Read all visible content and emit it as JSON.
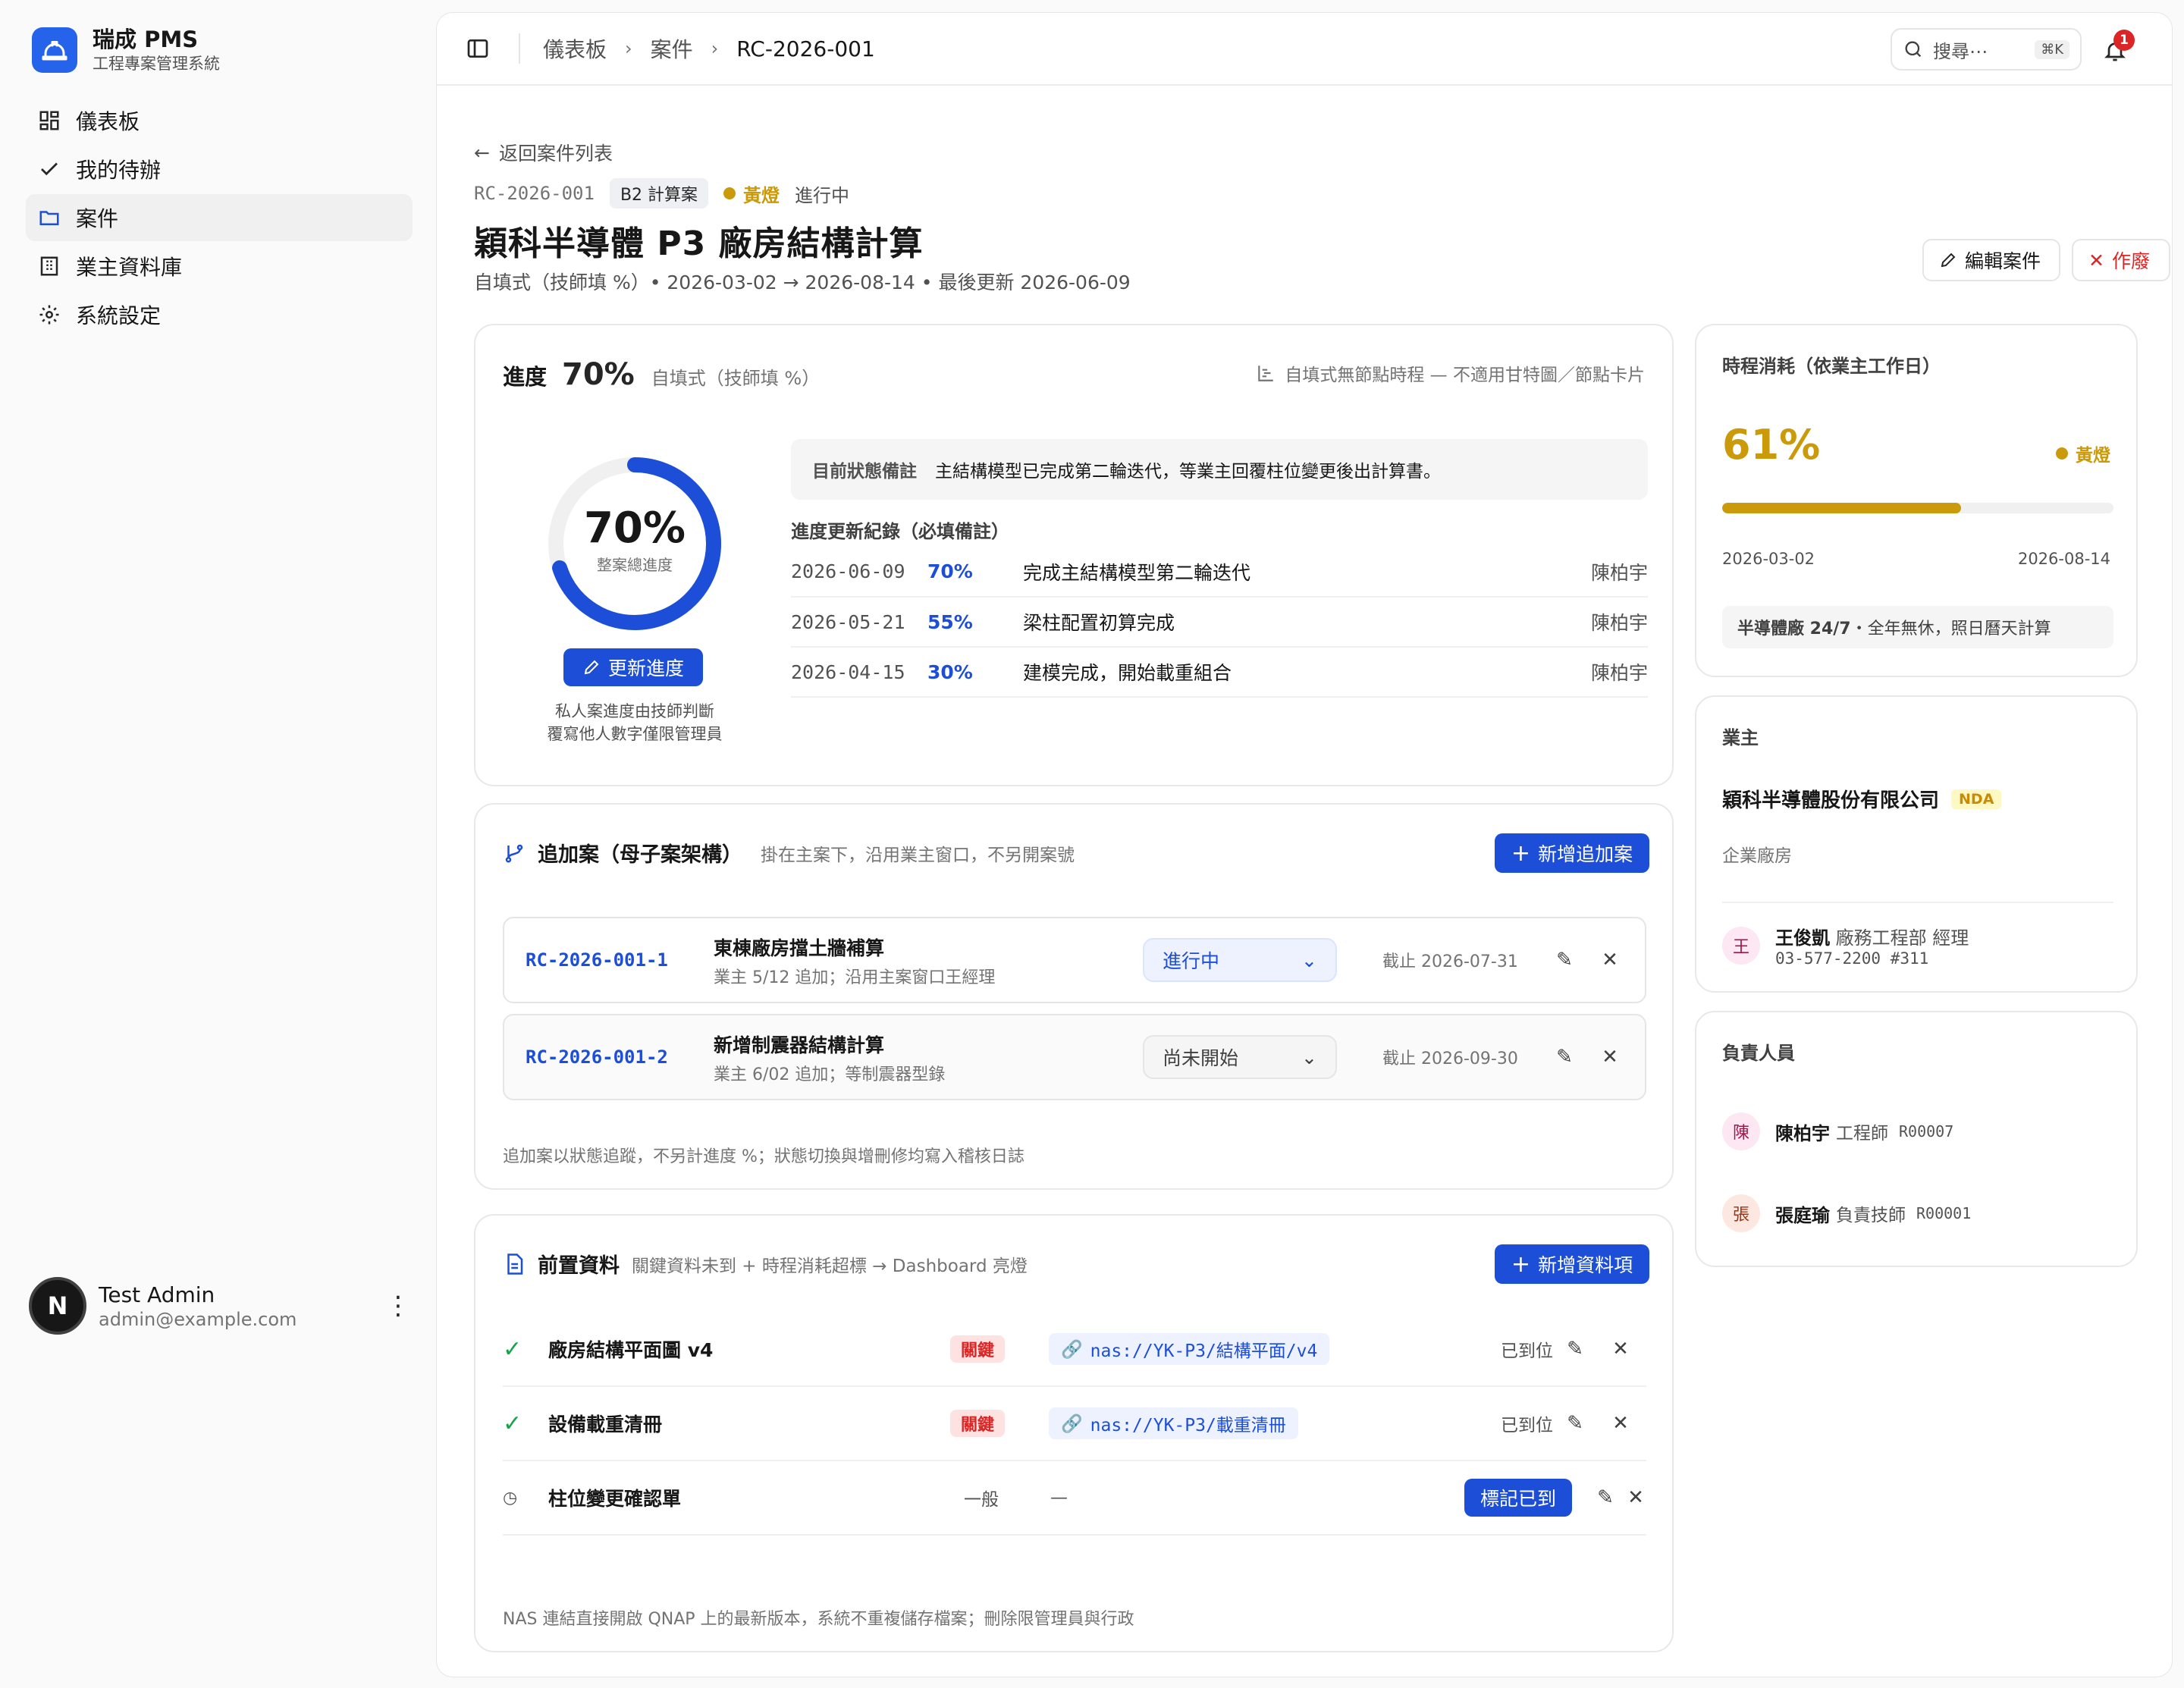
{
  "app": {
    "title": "瑞成 PMS",
    "subtitle": "工程專案管理系統"
  },
  "nav": [
    {
      "label": "儀表板",
      "icon": "dashboard-icon"
    },
    {
      "label": "我的待辦",
      "icon": "check-icon"
    },
    {
      "label": "案件",
      "icon": "folder-icon",
      "active": true
    },
    {
      "label": "業主資料庫",
      "icon": "building-icon"
    },
    {
      "label": "系統設定",
      "icon": "gear-icon"
    }
  ],
  "user": {
    "initial": "N",
    "name": "Test Admin",
    "email": "admin@example.com"
  },
  "breadcrumb": {
    "b1": "儀表板",
    "b2": "案件",
    "b3": "RC-2026-001"
  },
  "search": {
    "placeholder": "搜尋⋯",
    "shortcut": "⌘K"
  },
  "notifications": {
    "count": "1"
  },
  "header": {
    "back": "返回案件列表",
    "case_id": "RC-2026-001",
    "type_badge": "B2 計算案",
    "light": "黃燈",
    "status": "進行中",
    "title": "穎科半導體 P3 廠房結構計算",
    "subline": "自填式（技師填 %）• 2026-03-02 → 2026-08-14 • 最後更新 2026-06-09",
    "edit": "編輯案件",
    "void": "作廢"
  },
  "progress": {
    "label": "進度",
    "value": "70%",
    "fraction": 0.7,
    "mode": "自填式（技師填 %）",
    "note_right": "自填式無節點時程 — 不適用甘特圖／節點卡片",
    "ring_value": "70%",
    "ring_caption": "整案總進度",
    "update_btn": "更新進度",
    "hint1": "私人案進度由技師判斷",
    "hint2": "覆寫他人數字僅限管理員",
    "remark_label": "目前狀態備註",
    "remark_text": "主結構模型已完成第二輪迭代，等業主回覆柱位變更後出計算書。",
    "log_title": "進度更新紀錄（必填備註）",
    "log": [
      {
        "date": "2026-06-09",
        "pct": "70%",
        "desc": "完成主結構模型第二輪迭代",
        "by": "陳柏宇"
      },
      {
        "date": "2026-05-21",
        "pct": "55%",
        "desc": "梁柱配置初算完成",
        "by": "陳柏宇"
      },
      {
        "date": "2026-04-15",
        "pct": "30%",
        "desc": "建模完成，開始載重組合",
        "by": "陳柏宇"
      }
    ]
  },
  "subcases": {
    "title": "追加案（母子案架構）",
    "hint": "掛在主案下，沿用業主窗口，不另開案號",
    "add": "新增追加案",
    "items": [
      {
        "id": "RC-2026-001-1",
        "name": "東棟廠房擋土牆補算",
        "note": "業主 5/12 追加；沿用主案窗口王經理",
        "status": "進行中",
        "due": "截止 2026-07-31"
      },
      {
        "id": "RC-2026-001-2",
        "name": "新增制震器結構計算",
        "note": "業主 6/02 追加；等制震器型錄",
        "status": "尚未開始",
        "due": "截止 2026-09-30"
      }
    ],
    "footer": "追加案以狀態追蹤，不另計進度 %；狀態切換與增刪修均寫入稽核日誌"
  },
  "prereq": {
    "title": "前置資料",
    "hint": "關鍵資料未到 + 時程消耗超標 → Dashboard 亮燈",
    "add": "新增資料項",
    "items": [
      {
        "name": "廠房結構平面圖 v4",
        "level": "關鍵",
        "link": "nas://YK-P3/結構平面/v4",
        "state": "已到位"
      },
      {
        "name": "設備載重清冊",
        "level": "關鍵",
        "link": "nas://YK-P3/載重清冊",
        "state": "已到位"
      },
      {
        "name": "柱位變更確認單",
        "level": "一般",
        "link": "—",
        "state": "標記已到"
      }
    ],
    "footer": "NAS 連結直接開啟 QNAP 上的最新版本，系統不重複儲存檔案；刪除限管理員與行政"
  },
  "schedule": {
    "title": "時程消耗（依業主工作日）",
    "value": "61%",
    "fraction": 0.61,
    "light": "黃燈",
    "start": "2026-03-02",
    "end": "2026-08-14",
    "note_bold": "半導體廠 24/7",
    "note_rest": "・全年無休，照日曆天計算"
  },
  "owner": {
    "title": "業主",
    "company": "穎科半導體股份有限公司",
    "nda": "NDA",
    "kind": "企業廠房",
    "contact_initial": "王",
    "contact_name": "王俊凱",
    "contact_role": "廠務工程部 經理",
    "contact_phone": "03-577-2200 #311"
  },
  "staff": {
    "title": "負責人員",
    "people": [
      {
        "initial": "陳",
        "name": "陳柏宇",
        "role": "工程師",
        "code": "R00007"
      },
      {
        "initial": "張",
        "name": "張庭瑜",
        "role": "負責技師",
        "code": "R00001"
      }
    ]
  },
  "colors": {
    "accent": "#1d4ed8",
    "amber": "#ca9a0a",
    "danger": "#dc2626",
    "success": "#16a34a"
  }
}
